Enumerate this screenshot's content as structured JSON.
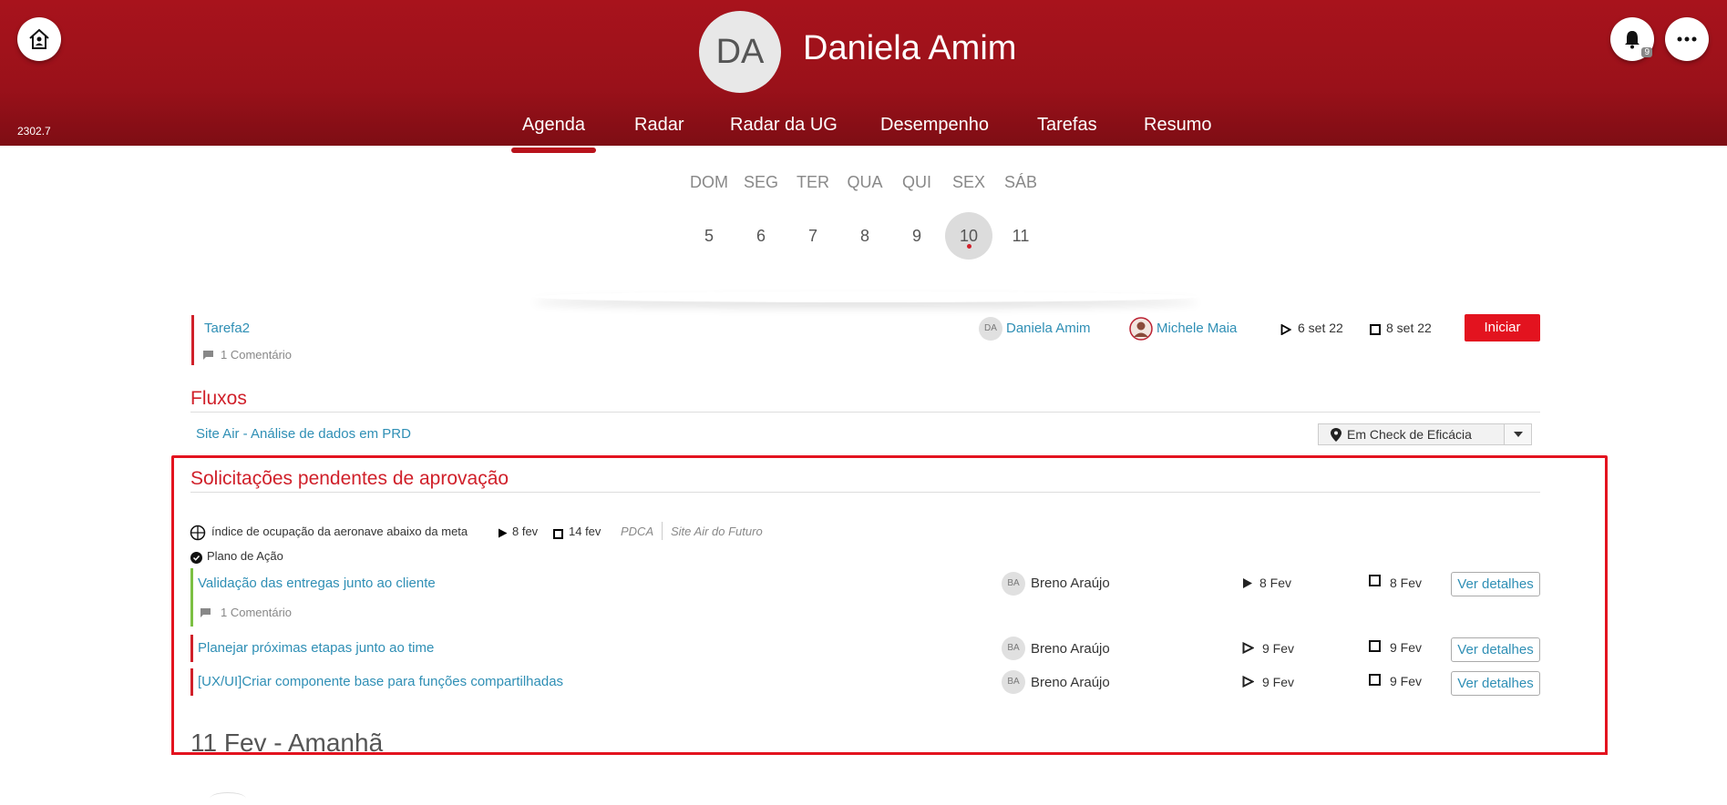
{
  "header": {
    "version": "2302.7",
    "avatar_initials": "DA",
    "user_name": "Daniela Amim",
    "notification_count": "9",
    "colors": {
      "brand": "#a8131c",
      "accent": "#e3131f"
    }
  },
  "nav": {
    "items": [
      "Agenda",
      "Radar",
      "Radar da UG",
      "Desempenho",
      "Tarefas",
      "Resumo"
    ],
    "active": "Agenda"
  },
  "week": {
    "days": [
      "DOM",
      "SEG",
      "TER",
      "QUA",
      "QUI",
      "SEX",
      "SÁB"
    ],
    "numbers": [
      "5",
      "6",
      "7",
      "8",
      "9",
      "10",
      "11"
    ],
    "selected": "10"
  },
  "task": {
    "title": "Tarefa2",
    "comments": "1 Comentário",
    "owner_initials": "DA",
    "owner": "Daniela Amim",
    "assignee": "Michele Maia",
    "start": "6 set 22",
    "end": "8 set 22",
    "action": "Iniciar"
  },
  "flows": {
    "title": "Fluxos",
    "item": "Site Air - Análise de dados em PRD",
    "status": "Em Check de Eficácia"
  },
  "approvals": {
    "title": "Solicitações pendentes de aprovação",
    "indicator": "índice de ocupação da aeronave abaixo da meta",
    "start": "8 fev",
    "end": "14 fev",
    "method": "PDCA",
    "project": "Site Air do Futuro",
    "plan": "Plano de Ação",
    "items": [
      {
        "title": "Validação das entregas junto ao cliente",
        "comments": "1 Comentário",
        "initials": "BA",
        "person": "Breno Araújo",
        "start": "8 Fev",
        "end": "8 Fev",
        "action": "Ver detalhes"
      },
      {
        "title": "Planejar próximas etapas junto ao time",
        "initials": "BA",
        "person": "Breno Araújo",
        "start": "9 Fev",
        "end": "9 Fev",
        "action": "Ver detalhes"
      },
      {
        "title": "[UX/UI]Criar componente base para funções compartilhadas",
        "initials": "BA",
        "person": "Breno Araújo",
        "start": "9 Fev",
        "end": "9 Fev",
        "action": "Ver detalhes"
      }
    ]
  },
  "next_day": "11 Fev - Amanhã"
}
